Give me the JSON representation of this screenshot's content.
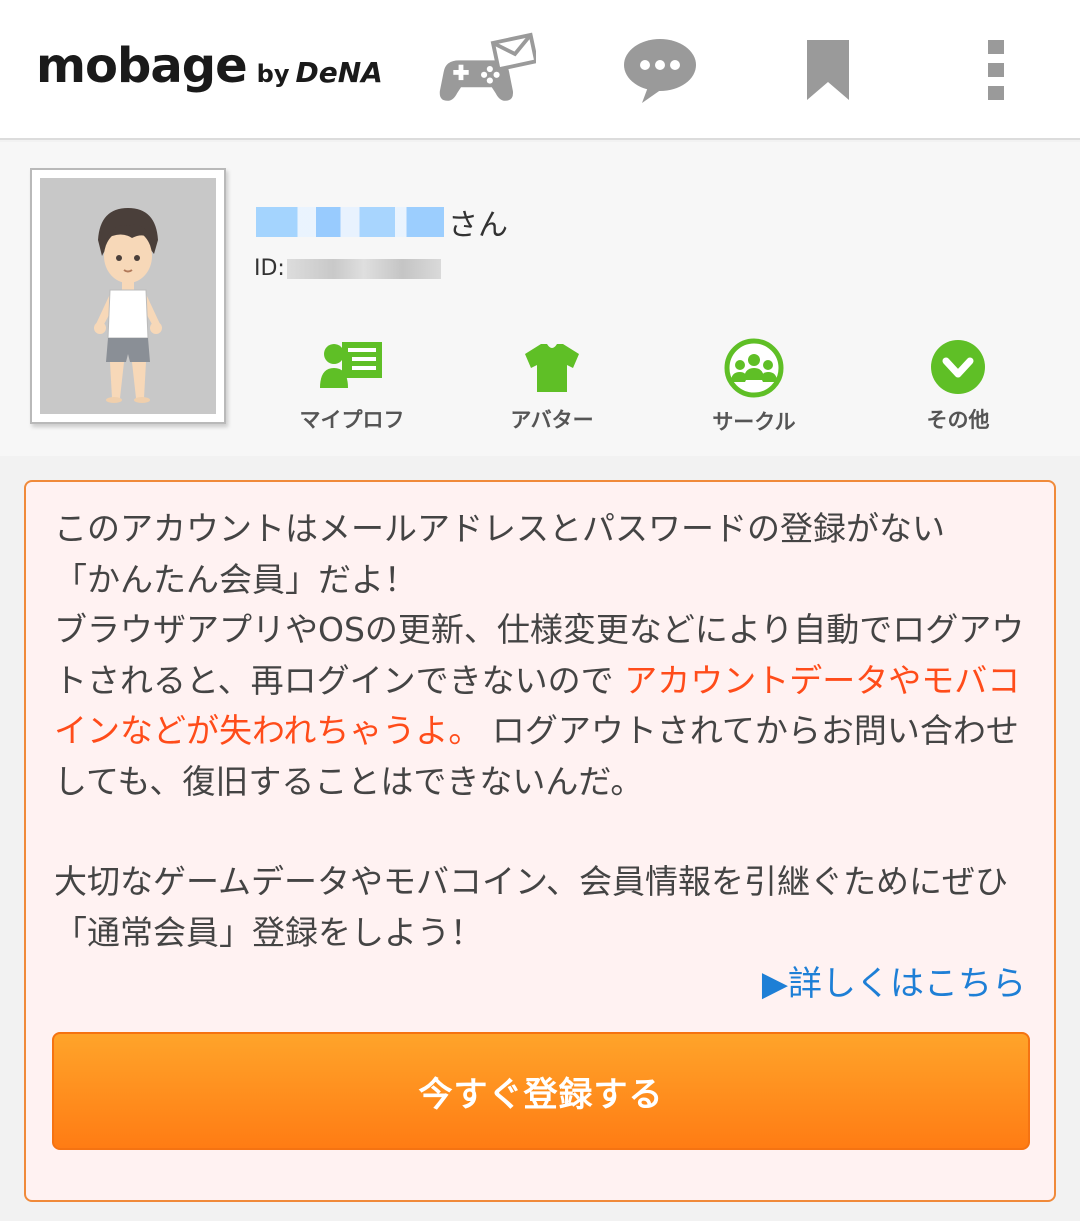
{
  "header": {
    "logo_main": "mobage",
    "logo_by": "by",
    "logo_brand": "DeNA",
    "icons": [
      "gamepad-mail-icon",
      "chat-bubble-icon",
      "bookmark-icon",
      "more-vertical-icon"
    ]
  },
  "profile": {
    "name_suffix": "さん",
    "id_label": "ID:",
    "menu": [
      {
        "label": "マイプロフ",
        "icon": "my-profile-icon"
      },
      {
        "label": "アバター",
        "icon": "avatar-shirt-icon"
      },
      {
        "label": "サークル",
        "icon": "circle-group-icon"
      },
      {
        "label": "その他",
        "icon": "chevron-down-icon"
      }
    ]
  },
  "notice": {
    "p1_line1": "このアカウントはメールアドレスとパスワードの登録がない",
    "p1_line2": "「かんたん会員」だよ！",
    "p2_normal1": "ブラウザアプリやOSの更新、仕様変更などにより自動でログアウトされると、再ログインできないので",
    "p2_red": "アカウントデータやモバコインなどが失われちゃうよ。",
    "p2_normal2": "ログアウトされてからお問い合わせしても、復旧することはできないんだ。",
    "p3_line1": "大切なゲームデータやモバコイン、会員情報を引継ぐためにぜひ「通常会員」登録をしよう！",
    "details_link": "▶詳しくはこちら",
    "register_button": "今すぐ登録する"
  },
  "colors": {
    "accent_green": "#5fbf26",
    "accent_orange": "#ff8a1c",
    "warning_red": "#ff4c1a",
    "link_blue": "#1e7fd6"
  }
}
